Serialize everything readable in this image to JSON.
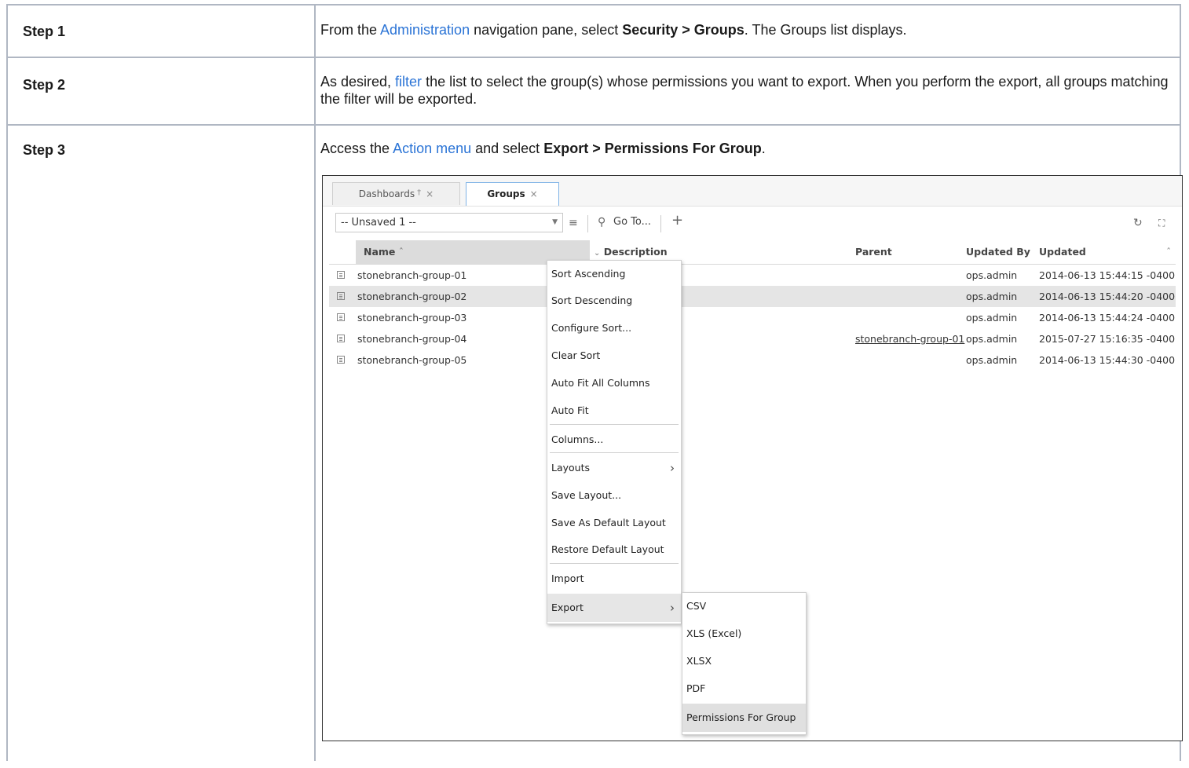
{
  "steps": [
    {
      "label": "Step 1",
      "text_parts": [
        "From the ",
        "Administration",
        " navigation pane, select ",
        "Security > Groups",
        ". The Groups list displays."
      ]
    },
    {
      "label": "Step 2",
      "text_parts": [
        "As desired, ",
        "filter",
        " the list to select the group(s) whose permissions you want to export. When you perform the export, all groups matching the filter will be exported."
      ]
    },
    {
      "label": "Step 3",
      "text_parts": [
        "Access the ",
        "Action menu",
        " and select ",
        "Export > Permissions For Group",
        "."
      ]
    }
  ],
  "app": {
    "tabs": [
      {
        "label": "Dashboards",
        "pin": "†",
        "close": "×"
      },
      {
        "label": "Groups",
        "close": "×"
      }
    ],
    "filter_value": "-- Unsaved 1 --",
    "goto_label": "Go To...",
    "columns": {
      "name": "Name",
      "description": "Description",
      "parent": "Parent",
      "updated_by": "Updated By",
      "updated": "Updated"
    },
    "rows": [
      {
        "name": "stonebranch-group-01",
        "parent": "",
        "updated_by": "ops.admin",
        "updated": "2014-06-13 15:44:15 -0400"
      },
      {
        "name": "stonebranch-group-02",
        "parent": "",
        "updated_by": "ops.admin",
        "updated": "2014-06-13 15:44:20 -0400"
      },
      {
        "name": "stonebranch-group-03",
        "parent": "",
        "updated_by": "ops.admin",
        "updated": "2014-06-13 15:44:24 -0400"
      },
      {
        "name": "stonebranch-group-04",
        "parent": "stonebranch-group-01",
        "updated_by": "ops.admin",
        "updated": "2015-07-27 15:16:35 -0400"
      },
      {
        "name": "stonebranch-group-05",
        "parent": "",
        "updated_by": "ops.admin",
        "updated": "2014-06-13 15:44:30 -0400"
      }
    ],
    "context_menu": [
      "Sort Ascending",
      "Sort Descending",
      "Configure Sort...",
      "Clear Sort",
      "Auto Fit All Columns",
      "Auto Fit",
      "Columns...",
      "Layouts",
      "Save Layout...",
      "Save As Default Layout",
      "Restore Default Layout",
      "Import",
      "Export"
    ],
    "export_submenu": [
      "CSV",
      "XLS (Excel)",
      "XLSX",
      "PDF",
      "Permissions For Group"
    ]
  },
  "colors": {
    "link": "#2b74d6",
    "table_border": "#b0b7c3",
    "menu_highlight": "#e6e6e6"
  }
}
